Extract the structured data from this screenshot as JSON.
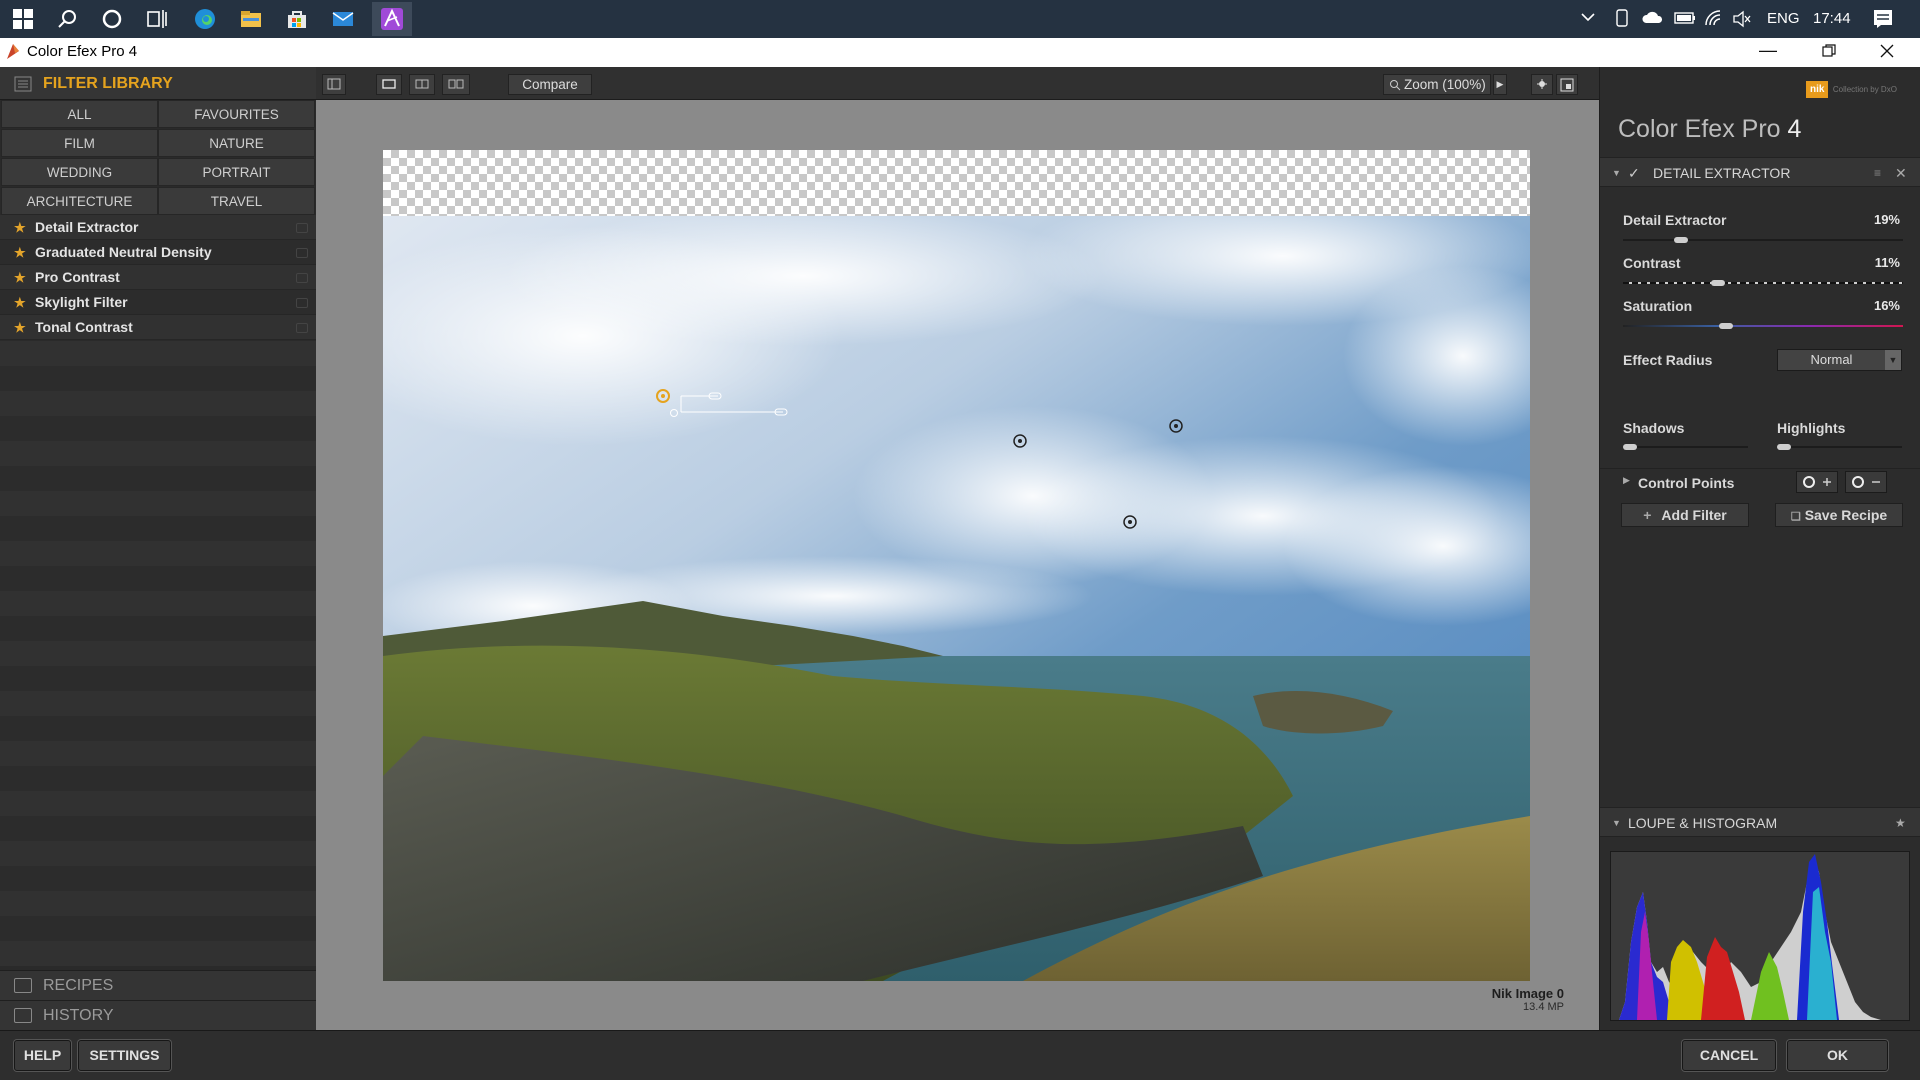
{
  "taskbar": {
    "icons": [
      "windows-start-icon",
      "search-icon",
      "cortana-icon",
      "task-view-icon",
      "edge-icon",
      "file-explorer-icon",
      "store-icon",
      "mail-icon",
      "affinity-icon"
    ],
    "language": "ENG",
    "time": "17:44"
  },
  "window": {
    "title": "Color Efex Pro 4"
  },
  "filter_library": {
    "header": "FILTER LIBRARY",
    "categories": [
      "ALL",
      "FAVOURITES",
      "FILM",
      "NATURE",
      "WEDDING",
      "PORTRAIT",
      "ARCHITECTURE",
      "TRAVEL"
    ],
    "filters": [
      "Detail Extractor",
      "Graduated Neutral Density",
      "Pro Contrast",
      "Skylight Filter",
      "Tonal Contrast"
    ],
    "recipes_label": "RECIPES",
    "history_label": "HISTORY"
  },
  "toolbar": {
    "compare_label": "Compare",
    "zoom_label": "Zoom (100%)"
  },
  "image_info": {
    "name": "Nik Image 0",
    "size": "13.4 MP"
  },
  "right_panel": {
    "brand_small": "nik",
    "brand_sub": "Collection by DxO",
    "app_name": "Color Efex Pro",
    "app_version": "4",
    "filter_section": "DETAIL EXTRACTOR",
    "sliders": [
      {
        "label": "Detail Extractor",
        "value": "19%",
        "fraction": 0.19
      },
      {
        "label": "Contrast",
        "value": "11%",
        "fraction": 0.33
      },
      {
        "label": "Saturation",
        "value": "16%",
        "fraction": 0.36
      }
    ],
    "effect_radius_label": "Effect Radius",
    "effect_radius_value": "Normal",
    "shadows_label": "Shadows",
    "highlights_label": "Highlights",
    "control_points_label": "Control Points",
    "add_filter_label": "Add Filter",
    "save_recipe_label": "Save Recipe",
    "loupe_label": "LOUPE & HISTOGRAM"
  },
  "bottom": {
    "help_label": "HELP",
    "settings_label": "SETTINGS",
    "cancel_label": "CANCEL",
    "ok_label": "OK"
  },
  "colors": {
    "accent": "#e5a31e",
    "panel": "#2c2c2c",
    "canvas": "#8a8a8a"
  }
}
